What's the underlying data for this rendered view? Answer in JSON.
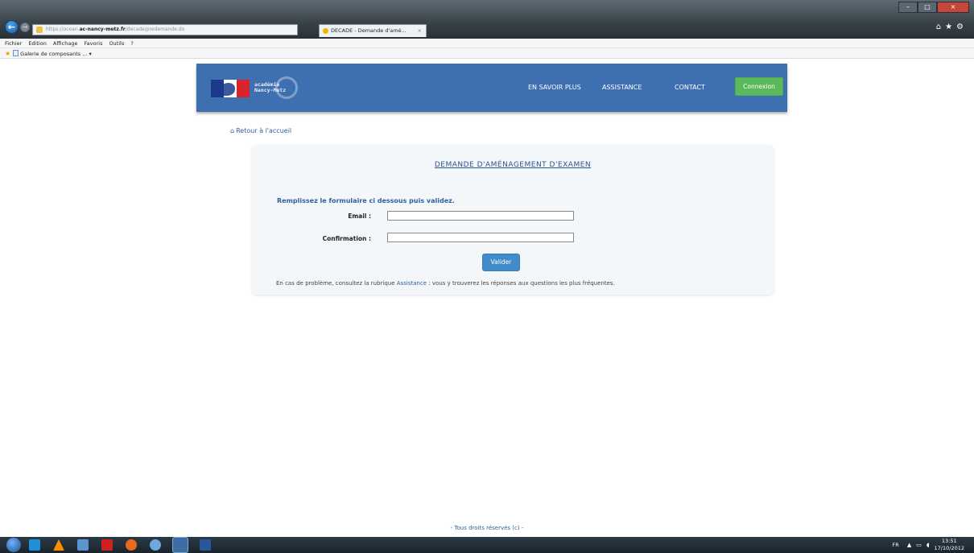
{
  "browser": {
    "url_prefix": "https://ocean.",
    "url_host": "ac-nancy-metz.fr",
    "url_path": "/decade/predemande.do",
    "tab_title": "DECADE - Demande d'amé...",
    "menu": [
      "Fichier",
      "Edition",
      "Affichage",
      "Favoris",
      "Outils",
      "?"
    ],
    "favorites_item": "Galerie de composants ... ▾"
  },
  "header": {
    "logo_text_line1": "académie",
    "logo_text_line2": "Nancy-Metz",
    "nav": [
      "EN SAVOIR PLUS",
      "ASSISTANCE",
      "CONTACT"
    ],
    "connexion_label": "Connexion"
  },
  "page": {
    "back_link": "Retour à l'accueil",
    "title": "DEMANDE D'AMÉNAGEMENT D'EXAMEN",
    "instructions": "Remplissez le formulaire ci dessous puis validez.",
    "email_label": "Email :",
    "confirmation_label": "Confirmation :",
    "email_value": "",
    "confirmation_value": "",
    "submit_label": "Valider",
    "help_prefix": "En cas de problème, consultez la rubrique ",
    "help_link": "Assistance",
    "help_suffix": " : vous y trouverez les réponses aux questions les plus fréquentes.",
    "footer": "- Tous droits réservés (c) -"
  },
  "taskbar": {
    "language": "FR",
    "time": "13:51",
    "date": "17/10/2012"
  },
  "colors": {
    "header_bg": "#3e6fb0",
    "connexion_bg": "#5cb85c",
    "valider_bg": "#428bca",
    "link": "#2f5f9e"
  }
}
